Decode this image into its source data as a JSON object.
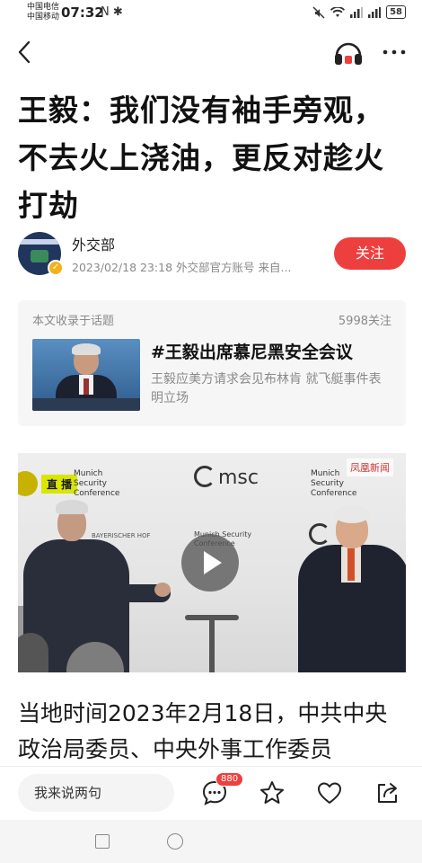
{
  "status_bar": {
    "carrier_1": "中国电信",
    "carrier_2": "中国移动",
    "time": "07:32",
    "left_icons": "N ✱",
    "battery": "58"
  },
  "article": {
    "headline": "王毅：我们没有袖手旁观，不去火上浇油，更反对趁火打劫",
    "author": {
      "name": "外交部",
      "meta": "2023/02/18 23:18 外交部官方账号 来自...",
      "follow_label": "关注"
    },
    "topic": {
      "label": "本文收录于话题",
      "count": "5998关注",
      "title": "#王毅出席慕尼黑安全会议",
      "desc": "王毅应美方请求会见布林肯 就飞艇事件表明立场"
    },
    "video": {
      "live_label": "直 播",
      "sign_left": "Munich Security Conference",
      "logo": "msc",
      "sign_right": "Munich Security Conference",
      "sign_center": "Munich Security Conference",
      "backdrop_text": "BAYERISCHER HOF",
      "watermark": "凤凰新闻"
    },
    "body_text": "当地时间2023年2月18日，中共中央政治局委员、中央外事工作委员"
  },
  "bottom_bar": {
    "comment_placeholder": "我来说两句",
    "comment_count": "880"
  },
  "icons": {
    "back": "chevron-left",
    "listen": "headphones",
    "more": "ellipsis",
    "comments": "speech-bubble",
    "favorite": "star",
    "like": "heart",
    "share": "share-arrow"
  },
  "colors": {
    "accent": "#ee3f3f",
    "verified": "#f2b21b"
  }
}
